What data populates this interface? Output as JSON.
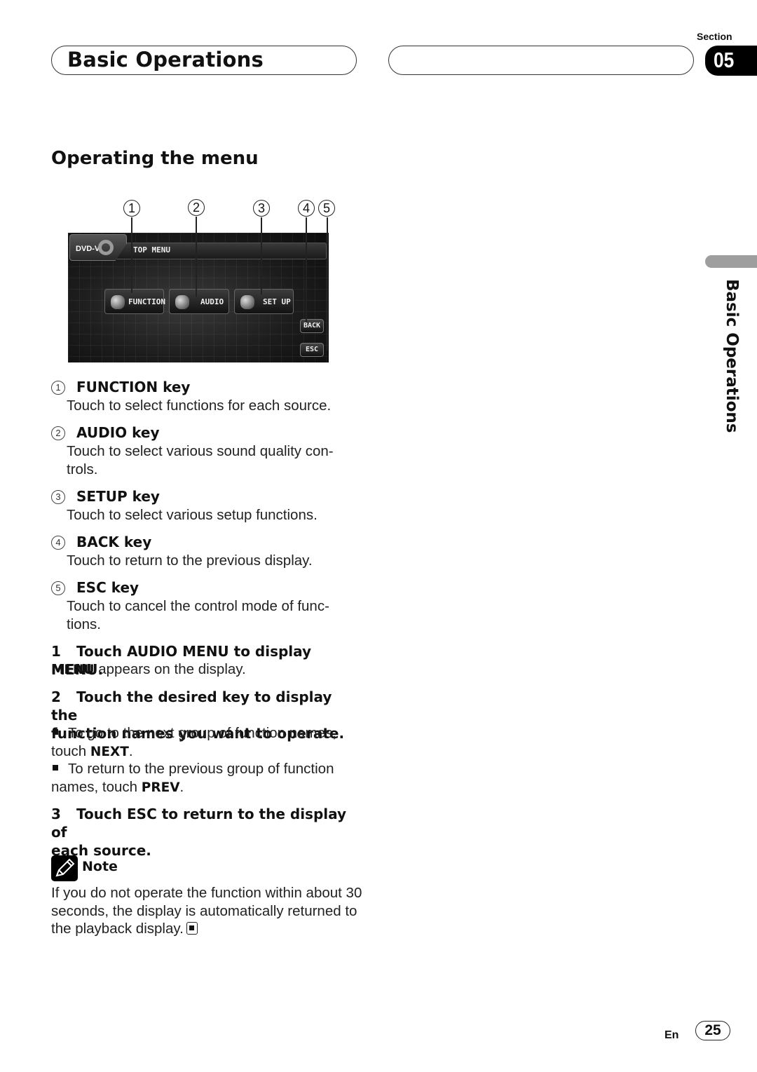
{
  "header": {
    "chapter_title": "Basic Operations",
    "section_label": "Section",
    "section_number": "05"
  },
  "main": {
    "section_heading": "Operating the menu",
    "figure": {
      "callouts": [
        "1",
        "2",
        "3",
        "4",
        "5"
      ],
      "screen": {
        "source_label": "DVD-V",
        "title": "TOP MENU",
        "keys": [
          {
            "label": "FUNCTION",
            "icon": "function-icon"
          },
          {
            "label": "AUDIO",
            "icon": "speaker-icon"
          },
          {
            "label": "SET UP",
            "icon": "setup-icon"
          }
        ],
        "back_label": "BACK",
        "esc_label": "ESC"
      }
    },
    "keys": [
      {
        "num": "1",
        "title": "FUNCTION key",
        "desc": "Touch to select functions for each source."
      },
      {
        "num": "2",
        "title": "AUDIO key",
        "desc": "Touch to select various sound quality con-\ntrols."
      },
      {
        "num": "3",
        "title": "SETUP key",
        "desc": "Touch to select various setup functions."
      },
      {
        "num": "4",
        "title": "BACK key",
        "desc": "Touch to return to the previous display."
      },
      {
        "num": "5",
        "title": "ESC key",
        "desc": "Touch to cancel the control mode of func-\ntions."
      }
    ],
    "steps": [
      {
        "num": "1",
        "title": "Touch AUDIO MENU to display MENU.",
        "body_bold": "MENU",
        "body_rest": " appears on the display."
      },
      {
        "num": "2",
        "title_line1": "Touch the desired key to display the",
        "title_line2": "function names you want to operate.",
        "bullets": [
          {
            "text_line1": "To go to the next group of function names,",
            "text_pre": "touch ",
            "bold": "NEXT",
            "text_post": "."
          },
          {
            "text_line1": "To return to the previous group of function",
            "text_pre": "names, touch ",
            "bold": "PREV",
            "text_post": "."
          }
        ]
      },
      {
        "num": "3",
        "title_line1": "Touch ESC to return to the display of",
        "title_line2": "each source."
      }
    ],
    "note": {
      "label": "Note",
      "line1": "If you do not operate the function within about 30",
      "line2": "seconds, the display is automatically returned to",
      "line3": "the playback display."
    }
  },
  "side_tab": {
    "label": "Basic Operations"
  },
  "footer": {
    "language": "En",
    "page_number": "25"
  }
}
